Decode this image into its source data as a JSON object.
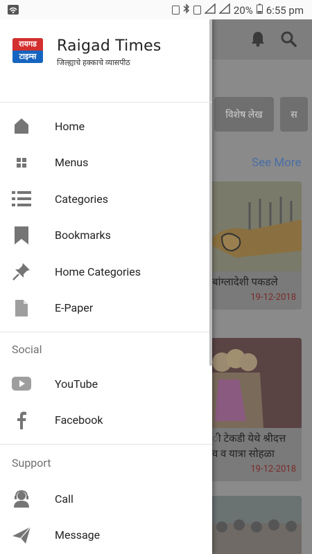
{
  "status_bar": {
    "battery": "20%",
    "time": "6:55 pm"
  },
  "background": {
    "chip_label": "विशेष लेख",
    "chip_label_2": "स",
    "see_more": "See More",
    "cards": [
      {
        "title": "बांग्लादेशी पकडले",
        "date": "19-12-2018"
      },
      {
        "title": "ी टेकडी येथे श्रीदत्त\nव व यात्रा सोहळा",
        "date": "19-12-2018"
      }
    ]
  },
  "drawer": {
    "logo_top": "रायगड",
    "logo_bottom": "टाइम्स",
    "title": "Raigad Times",
    "subtitle": "जिल्ह्याचे हक्काचे व्यासपीठ",
    "main_items": [
      {
        "label": "Home",
        "icon": "home-icon"
      },
      {
        "label": "Menus",
        "icon": "grid-icon"
      },
      {
        "label": "Categories",
        "icon": "list-icon"
      },
      {
        "label": "Bookmarks",
        "icon": "bookmark-icon"
      },
      {
        "label": "Home Categories",
        "icon": "pin-icon"
      },
      {
        "label": "E-Paper",
        "icon": "file-icon"
      }
    ],
    "social_header": "Social",
    "social_items": [
      {
        "label": "YouTube",
        "icon": "youtube-icon"
      },
      {
        "label": "Facebook",
        "icon": "facebook-icon"
      }
    ],
    "support_header": "Support",
    "support_items": [
      {
        "label": "Call",
        "icon": "headset-icon"
      },
      {
        "label": "Message",
        "icon": "send-icon"
      }
    ]
  }
}
